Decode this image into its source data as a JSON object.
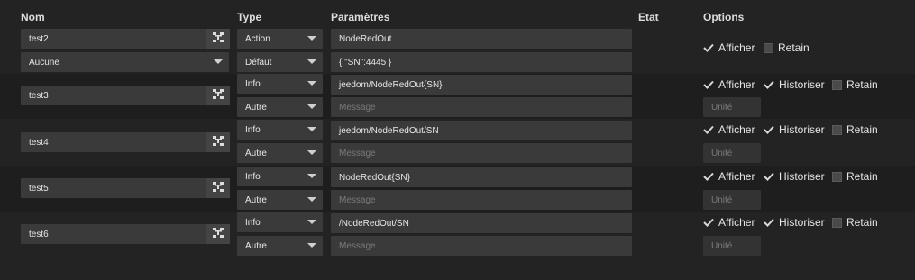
{
  "headers": {
    "nom": "Nom",
    "type": "Type",
    "parametres": "Paramètres",
    "etat": "Etat",
    "options": "Options"
  },
  "rows": [
    {
      "name": "test2",
      "sub_name": "Aucune",
      "type1": "Action",
      "type2": "Défaut",
      "param1": "NodeRedOut",
      "param2": "{  \"SN\":4445 }",
      "afficher": "Afficher",
      "retain": "Retain"
    },
    {
      "name": "test3",
      "type1": "Info",
      "type2": "Autre",
      "param1": "jeedom/NodeRedOut{SN}",
      "param2_placeholder": "Message",
      "unit_placeholder": "Unité",
      "afficher": "Afficher",
      "historiser": "Historiser",
      "retain": "Retain"
    },
    {
      "name": "test4",
      "type1": "Info",
      "type2": "Autre",
      "param1": "jeedom/NodeRedOut/SN",
      "param2_placeholder": "Message",
      "unit_placeholder": "Unité",
      "afficher": "Afficher",
      "historiser": "Historiser",
      "retain": "Retain"
    },
    {
      "name": "test5",
      "type1": "Info",
      "type2": "Autre",
      "param1": "NodeRedOut{SN}",
      "param2_placeholder": "Message",
      "unit_placeholder": "Unité",
      "afficher": "Afficher",
      "historiser": "Historiser",
      "retain": "Retain"
    },
    {
      "name": "test6",
      "type1": "Info",
      "type2": "Autre",
      "param1": "/NodeRedOut/SN",
      "param2_placeholder": "Message",
      "unit_placeholder": "Unité",
      "afficher": "Afficher",
      "historiser": "Historiser",
      "retain": "Retain"
    }
  ],
  "colors": {
    "background": "#232323",
    "input": "#3a3a3a",
    "text": "#e6e6e6",
    "placeholder": "#7a7a7a"
  }
}
